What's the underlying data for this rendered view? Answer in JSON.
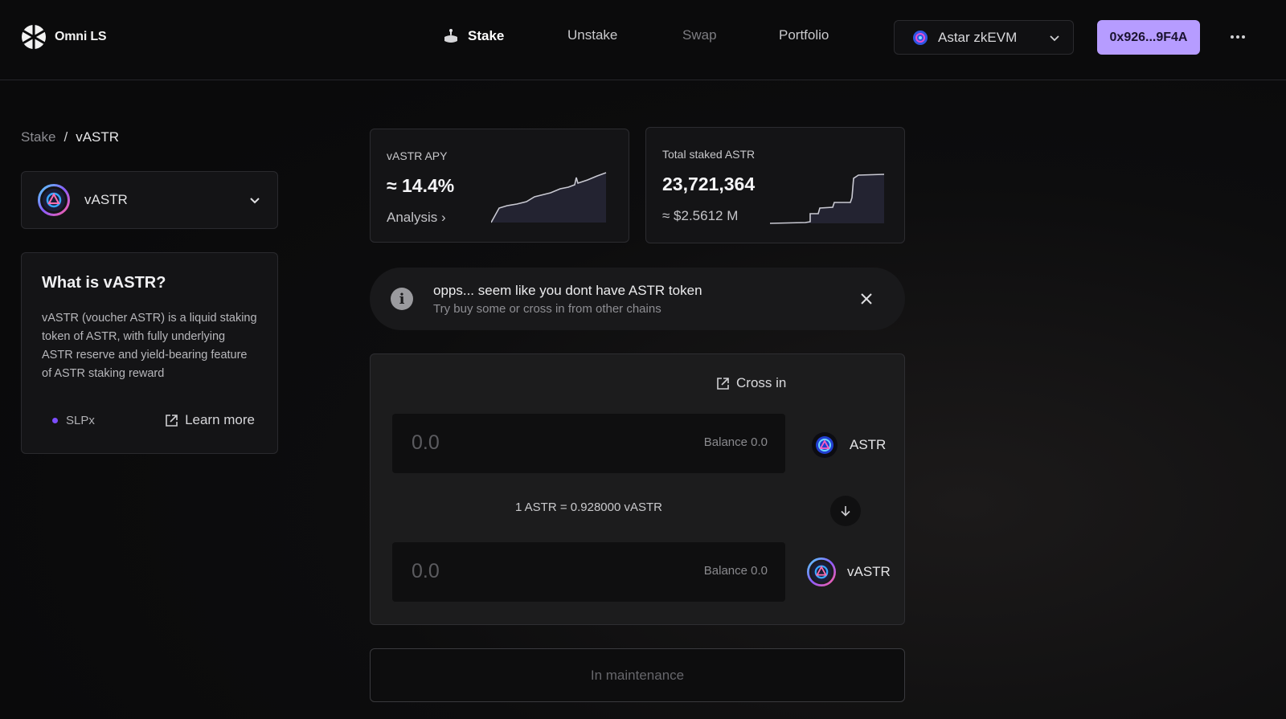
{
  "header": {
    "brand": "Omni LS",
    "nav": [
      {
        "label": "Stake"
      },
      {
        "label": "Unstake"
      },
      {
        "label": "Swap"
      },
      {
        "label": "Portfolio"
      }
    ],
    "network": "Astar zkEVM",
    "wallet": "0x926...9F4A"
  },
  "breadcrumb": {
    "parent": "Stake",
    "separator": "/",
    "current": "vASTR"
  },
  "token_select": {
    "label": "vASTR"
  },
  "info": {
    "title": "What is vASTR?",
    "body": "vASTR (voucher ASTR) is a liquid staking token of ASTR, with fully underlying ASTR reserve and yield-bearing feature of ASTR staking reward",
    "tag": "SLPx",
    "learn_more": "Learn more"
  },
  "stats": {
    "apy": {
      "label": "vASTR APY",
      "value": "≈ 14.4%",
      "link": "Analysis ›"
    },
    "total": {
      "label": "Total staked ASTR",
      "value": "23,721,364",
      "usd": "≈ $2.5612 M"
    }
  },
  "alert": {
    "title": "opps... seem like you dont have ASTR token",
    "subtitle": "Try buy some or cross in from other chains"
  },
  "swap": {
    "cross_in": "Cross in",
    "from": {
      "placeholder": "0.0",
      "balance": "Balance 0.0",
      "token": "ASTR"
    },
    "rate": "1 ASTR = 0.928000 vASTR",
    "to": {
      "placeholder": "0.0",
      "balance": "Balance 0.0",
      "token": "vASTR"
    }
  },
  "action_button": "In maintenance",
  "colors": {
    "accent": "#b69cff",
    "background": "#0a0a0b",
    "panel": "#141416"
  }
}
